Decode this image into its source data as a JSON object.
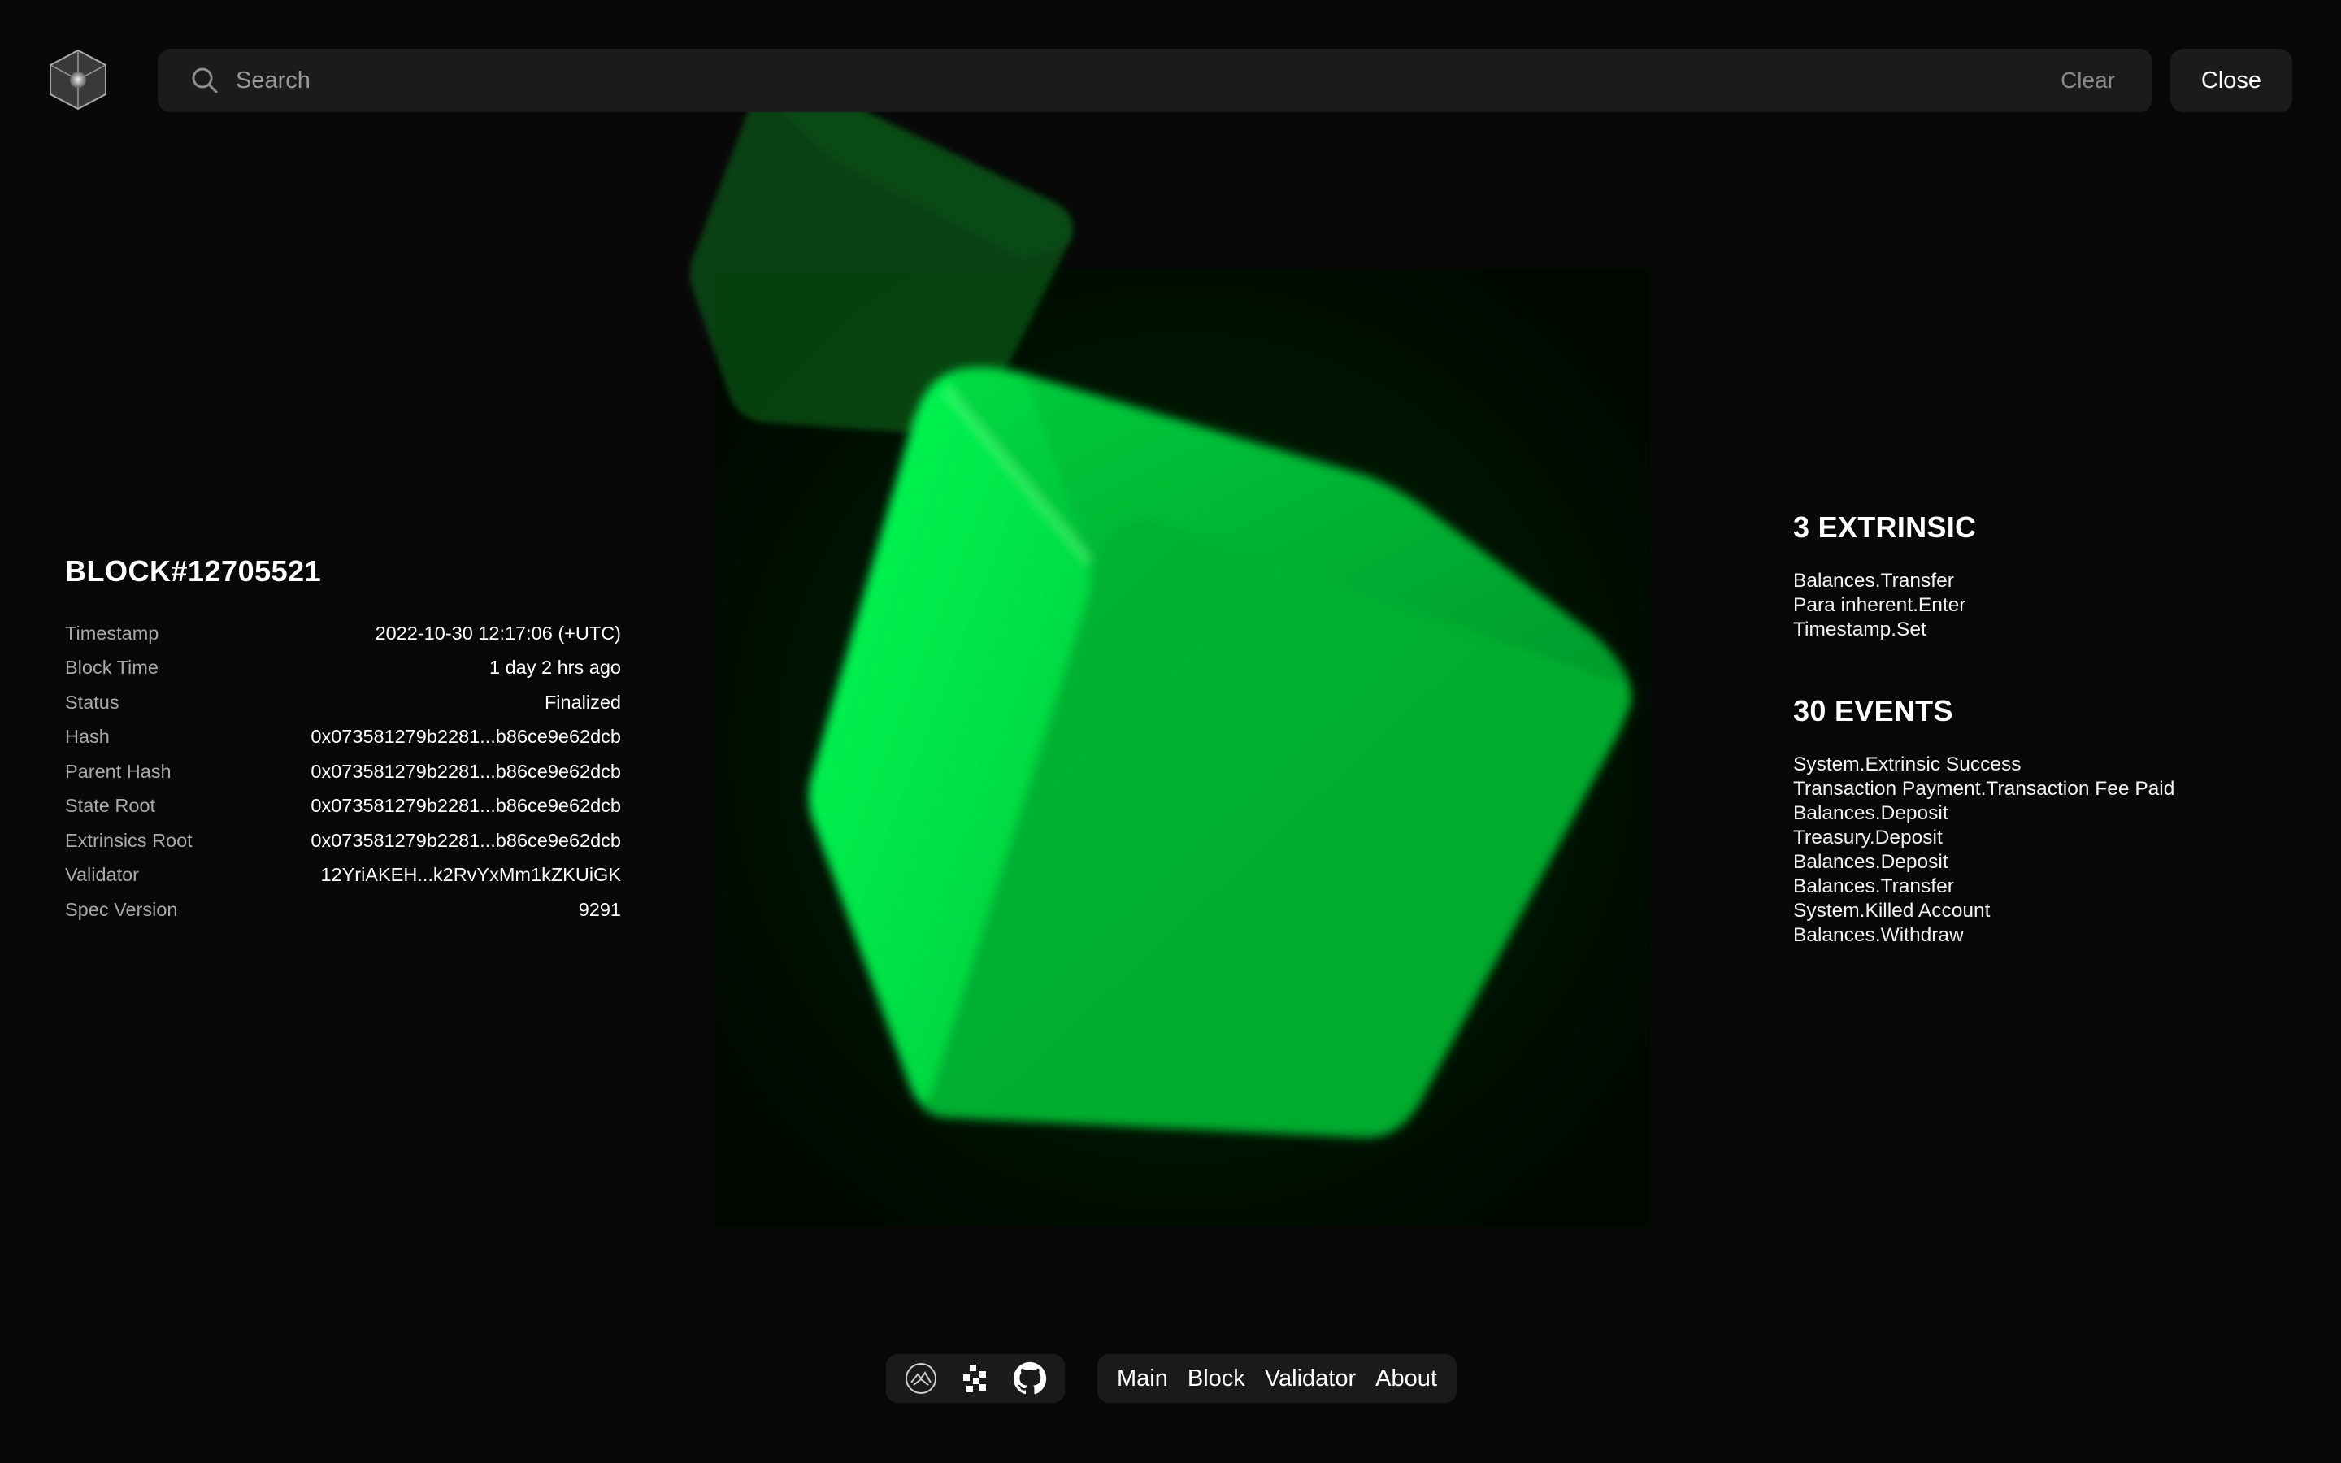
{
  "header": {
    "logo_icon": "cube-logo-icon",
    "search": {
      "placeholder": "Search",
      "value": ""
    },
    "clear_label": "Clear",
    "close_label": "Close"
  },
  "block": {
    "title": "BLOCK#12705521",
    "fields": [
      {
        "label": "Timestamp",
        "value": "2022-10-30 12:17:06 (+UTC)"
      },
      {
        "label": "Block Time",
        "value": "1 day 2 hrs ago"
      },
      {
        "label": "Status",
        "value": "Finalized"
      },
      {
        "label": "Hash",
        "value": "0x073581279b2281...b86ce9e62dcb"
      },
      {
        "label": "Parent Hash",
        "value": "0x073581279b2281...b86ce9e62dcb"
      },
      {
        "label": "State Root",
        "value": "0x073581279b2281...b86ce9e62dcb"
      },
      {
        "label": "Extrinsics Root",
        "value": "0x073581279b2281...b86ce9e62dcb"
      },
      {
        "label": "Validator",
        "value": "12YriAKEH...k2RvYxMm1kZKUiGK"
      },
      {
        "label": "Spec Version",
        "value": "9291"
      }
    ]
  },
  "extrinsics": {
    "title": "3 EXTRINSIC",
    "items": [
      "Balances.Transfer",
      "Para inherent.Enter",
      "Timestamp.Set"
    ]
  },
  "events": {
    "title": "30 EVENTS",
    "items": [
      "System.Extrinsic Success",
      "Transaction Payment.Transaction Fee Paid",
      "Balances.Deposit",
      "Treasury.Deposit",
      "Balances.Deposit",
      "Balances.Transfer",
      "System.Killed Account",
      "Balances.Withdraw"
    ]
  },
  "footer": {
    "social_icons": [
      "subsquid-icon",
      "polkadot-icon",
      "github-icon"
    ],
    "nav": [
      "Main",
      "Block",
      "Validator",
      "About"
    ]
  },
  "colors": {
    "background": "#080808",
    "panel": "#1b1b1b",
    "cube_green": "#00e040",
    "muted_text": "#a9a9a9"
  }
}
